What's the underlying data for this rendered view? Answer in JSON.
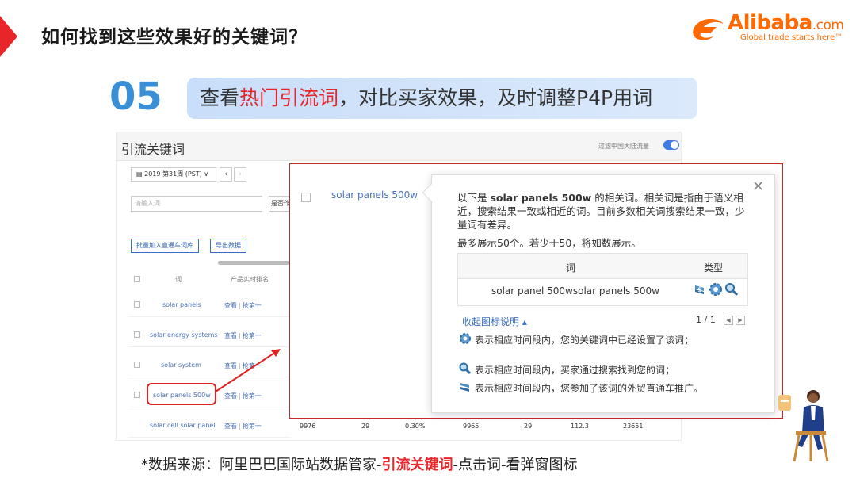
{
  "slide": {
    "title": "如何找到这些效果好的关键词？",
    "step_number": "05",
    "banner": {
      "prefix": "查看",
      "highlight": "热门引流词",
      "suffix": "，对比买家效果，及时调整P4P用词"
    },
    "source": {
      "prefix": "*数据来源：阿里巴巴国际站数据管家-",
      "highlight": "引流关键词",
      "suffix": "-点击词-看弹窗图标"
    }
  },
  "logo": {
    "name": "Alibaba",
    "domain": ".com",
    "tagline": "Global trade starts here™"
  },
  "panel": {
    "title": "引流关键词",
    "filter_label": "过滤中国大陆流量",
    "week_select": "2019 第31周 (PST)",
    "keyword_input_placeholder": "请输入词",
    "cooperate_select": "是否作",
    "buttons": {
      "bulk_add": "批量加入直通车词库",
      "export": "导出数据"
    },
    "columns": {
      "word": "词",
      "rank": "产品实时排名"
    },
    "action": {
      "view": "查看",
      "sep": "|",
      "grab": "抢第一"
    },
    "rows": [
      {
        "keyword": "solar panels"
      },
      {
        "keyword": "solar energy systems"
      },
      {
        "keyword": "solar system"
      },
      {
        "keyword": "solar panels 500w"
      },
      {
        "keyword": "solar cell solar panel"
      }
    ],
    "last_row_values": [
      "9976",
      "29",
      "0.30%",
      "9965",
      "29",
      "112.3",
      "23651"
    ]
  },
  "overlay": {
    "keyword": "solar panels 500w"
  },
  "popup": {
    "desc_pre": "以下是 ",
    "desc_keyword": "solar panels 500w",
    "desc_post": " 的相关词。相关词是指由于语义相近，搜索结果一致或相近的词。目前多数相关词搜索结果一致，少量词有差异。",
    "max_show": "最多展示50个。若少于50，将如数展示。",
    "table_header": {
      "word": "词",
      "type": "类型"
    },
    "table_rows": [
      {
        "word": "solar panel 500wsolar panels 500w"
      }
    ],
    "legend_toggle": "收起图标说明 ▴",
    "pager": "1 / 1",
    "legend": [
      {
        "icon": "gear-icon",
        "text": "表示相应时间段内，您的关键词中已经设置了该词；"
      },
      {
        "icon": "magnifier-icon",
        "text": "表示相应时间段内，买家通过搜索找到您的词；"
      },
      {
        "icon": "dollar-icon",
        "text": "表示相应时间段内，您参加了该词的外贸直通车推广。"
      }
    ]
  },
  "colors": {
    "accent_red": "#e8262a",
    "step_blue": "#3a8fd6",
    "alibaba_orange": "#ff6a00",
    "link_blue": "#4a73b8"
  }
}
